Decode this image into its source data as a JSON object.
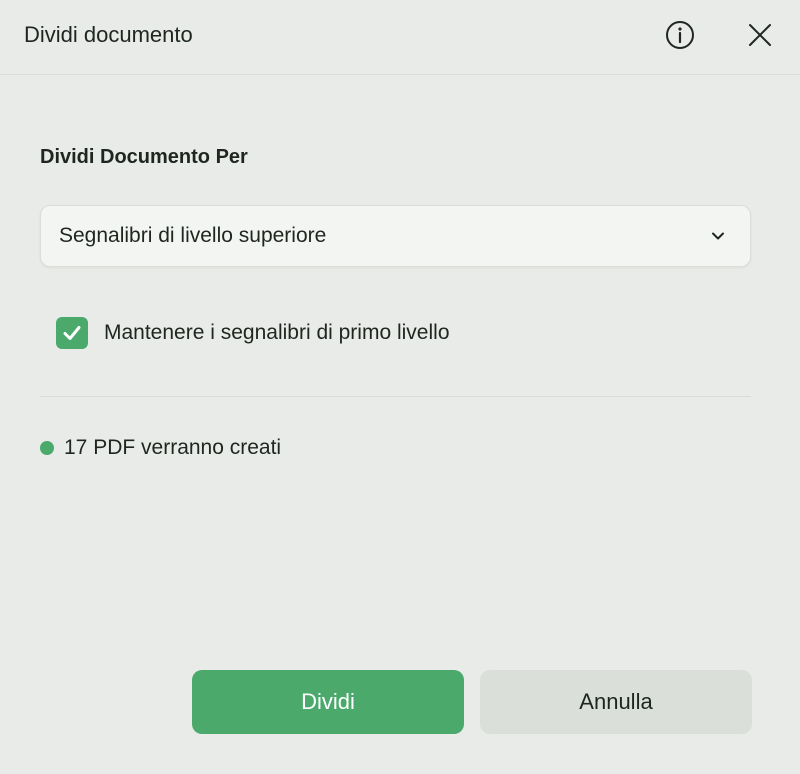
{
  "dialog": {
    "title": "Dividi documento",
    "icons": {
      "info": "info-icon",
      "close": "close-icon"
    }
  },
  "split": {
    "section_label": "Dividi Documento Per",
    "select_value": "Segnalibri di livello superiore",
    "checkbox": {
      "label": "Mantenere i segnalibri di primo livello",
      "checked": true
    },
    "status_text": "17 PDF verranno creati"
  },
  "buttons": {
    "primary": "Dividi",
    "secondary": "Annulla"
  },
  "colors": {
    "accent": "#4aa96b",
    "background": "#e8ebe7",
    "text": "#1f2620"
  }
}
